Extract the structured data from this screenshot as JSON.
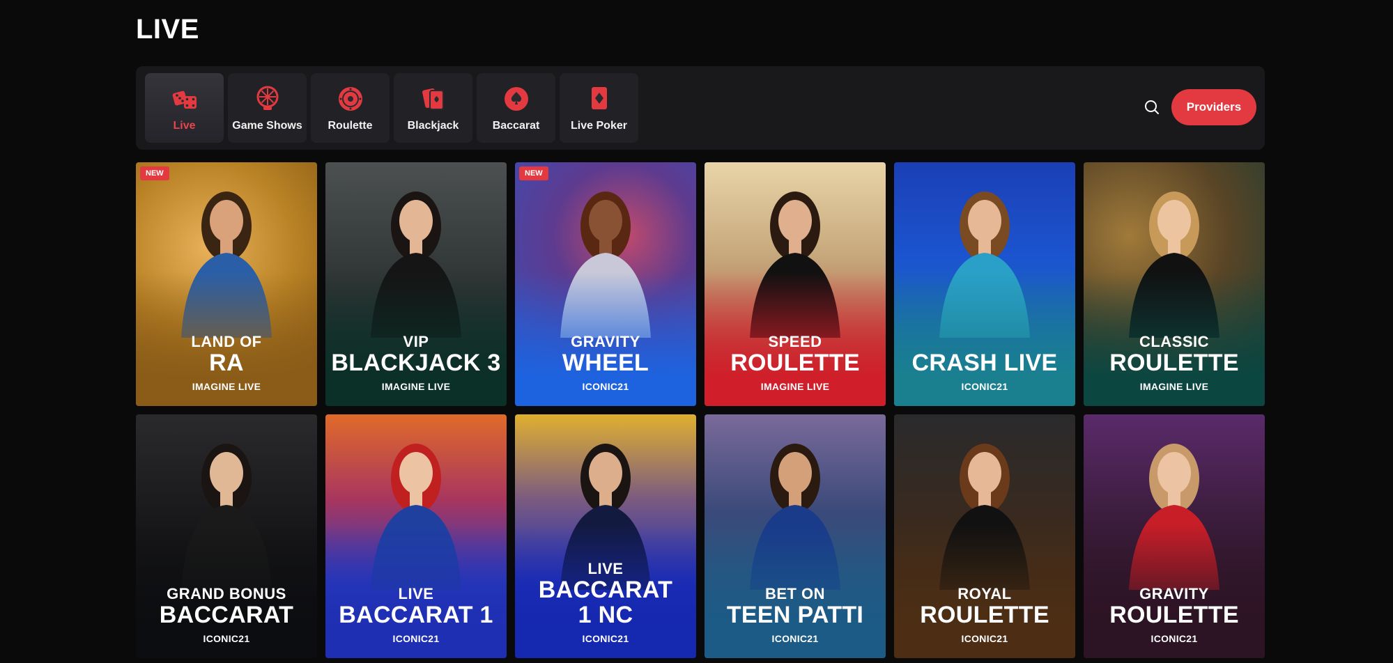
{
  "page": {
    "title": "LIVE"
  },
  "nav": {
    "tabs": [
      {
        "label": "Live",
        "icon": "dice-icon",
        "active": true
      },
      {
        "label": "Game Shows",
        "icon": "wheel-icon",
        "active": false
      },
      {
        "label": "Roulette",
        "icon": "roulette-icon",
        "active": false
      },
      {
        "label": "Blackjack",
        "icon": "cards-icon",
        "active": false
      },
      {
        "label": "Baccarat",
        "icon": "spade-icon",
        "active": false
      },
      {
        "label": "Live Poker",
        "icon": "diamond-card-icon",
        "active": false
      }
    ],
    "search_icon": "search-icon",
    "providers_label": "Providers"
  },
  "colors": {
    "accent": "#e23a40",
    "background": "#0a0a0b",
    "panel": "#19191c"
  },
  "games": [
    {
      "badge": "NEW",
      "pre": "LAND OF",
      "main": "RA",
      "provider": "IMAGINE LIVE",
      "theme": "gold"
    },
    {
      "badge": "",
      "pre": "VIP",
      "main": "BLACKJACK 3",
      "provider": "IMAGINE LIVE",
      "theme": "darkgreen"
    },
    {
      "badge": "NEW",
      "pre": "GRAVITY",
      "main": "WHEEL",
      "provider": "ICONIC21",
      "theme": "blue"
    },
    {
      "badge": "",
      "pre": "SPEED",
      "main": "ROULETTE",
      "provider": "IMAGINE LIVE",
      "theme": "red"
    },
    {
      "badge": "",
      "pre": "",
      "main": "CRASH LIVE",
      "provider": "ICONIC21",
      "theme": "teal"
    },
    {
      "badge": "",
      "pre": "CLASSIC",
      "main": "ROULETTE",
      "provider": "IMAGINE LIVE",
      "theme": "bronze"
    },
    {
      "badge": "",
      "pre": "GRAND BONUS",
      "main": "BACCARAT",
      "provider": "ICONIC21",
      "theme": "black"
    },
    {
      "badge": "",
      "pre": "LIVE",
      "main": "BACCARAT 1",
      "provider": "ICONIC21",
      "theme": "royalblue"
    },
    {
      "badge": "",
      "pre": "LIVE",
      "main": "BACCARAT\n1 NC",
      "provider": "ICONIC21",
      "theme": "navy"
    },
    {
      "badge": "",
      "pre": "BET ON",
      "main": "TEEN PATTI",
      "provider": "ICONIC21",
      "theme": "steel"
    },
    {
      "badge": "",
      "pre": "ROYAL",
      "main": "ROULETTE",
      "provider": "ICONIC21",
      "theme": "brown"
    },
    {
      "badge": "",
      "pre": "GRAVITY",
      "main": "ROULETTE",
      "provider": "ICONIC21",
      "theme": "plum"
    }
  ]
}
